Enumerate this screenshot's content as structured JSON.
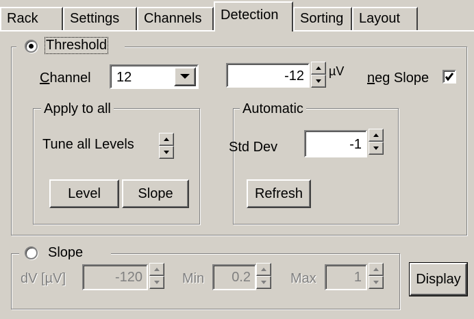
{
  "tabs": [
    {
      "label": "Rack"
    },
    {
      "label": "Settings"
    },
    {
      "label": "Channels"
    },
    {
      "label": "Detection",
      "active": true
    },
    {
      "label": "Sorting"
    },
    {
      "label": "Layout"
    }
  ],
  "threshold": {
    "radio_label": "Threshold",
    "selected": true,
    "channel_label_key": "C",
    "channel_label_rest": "hannel",
    "channel_value": "12",
    "level_value": "-12",
    "level_unit": "µV",
    "neg_slope_key": "n",
    "neg_slope_rest": "eg Slope",
    "neg_slope_checked": true,
    "apply_all": {
      "title": "Apply to all",
      "tune_label": "Tune all Levels",
      "level_button": "Level",
      "slope_button": "Slope"
    },
    "automatic": {
      "title": "Automatic",
      "stddev_label": "Std Dev",
      "stddev_value": "-1",
      "refresh_button": "Refresh"
    }
  },
  "slope": {
    "radio_label": "Slope",
    "selected": false,
    "dv_label": "dV [µV]",
    "dv_value": "-120",
    "min_label": "Min",
    "min_value": "0.2",
    "max_label": "Max",
    "max_value": "1"
  },
  "display_button": "Display",
  "colors": {
    "face": "#d4d0c8",
    "shadow": "#808080",
    "highlight": "#ffffff",
    "disabled_text": "#808080"
  }
}
